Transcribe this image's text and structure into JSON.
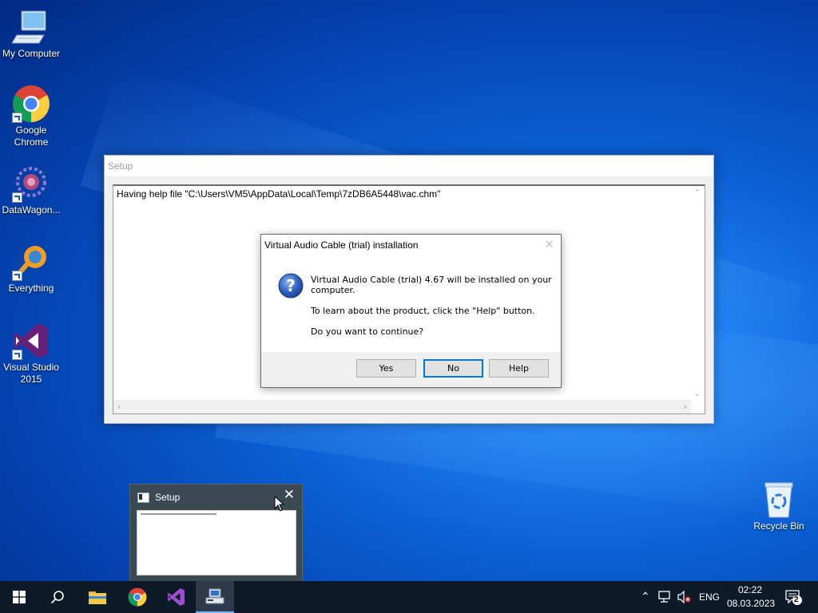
{
  "desktop": {
    "icons": [
      {
        "label": "My Computer",
        "icon": "computer-icon"
      },
      {
        "label": "Google\nChrome",
        "icon": "chrome-icon"
      },
      {
        "label": "DataWagon...",
        "icon": "datawagon-icon"
      },
      {
        "label": "Everything",
        "icon": "everything-icon"
      },
      {
        "label": "Visual Studio\n2015",
        "icon": "visual-studio-icon"
      },
      {
        "label": "Recycle Bin",
        "icon": "recycle-bin-icon"
      }
    ]
  },
  "setup_window": {
    "title": "Setup",
    "log_text": "Having help file \"C:\\Users\\VM5\\AppData\\Local\\Temp\\7zDB6A5448\\vac.chm\""
  },
  "dialog": {
    "title": "Virtual Audio Cable (trial) installation",
    "icon": "question-icon",
    "message_line1": "Virtual Audio Cable (trial) 4.67 will be installed on your",
    "message_line2": "computer.",
    "message_help": "To learn about the product, click the \"Help\" button.",
    "message_question": "Do you want to continue?",
    "buttons": {
      "yes": "Yes",
      "no": "No",
      "help": "Help"
    }
  },
  "taskbar_preview": {
    "title": "Setup"
  },
  "taskbar": {
    "apps": [
      "start-icon",
      "search-icon",
      "file-explorer-icon",
      "chrome-icon",
      "visual-studio-icon",
      "setup-app-icon"
    ],
    "tray": {
      "language": "ENG",
      "time": "02:22",
      "date": "08.03.2023",
      "notification_count": "2"
    }
  },
  "colors": {
    "taskbar_bg": "#0d1a27",
    "default_button_border": "#0078d7",
    "desktop_accent": "#0c5fd4"
  }
}
